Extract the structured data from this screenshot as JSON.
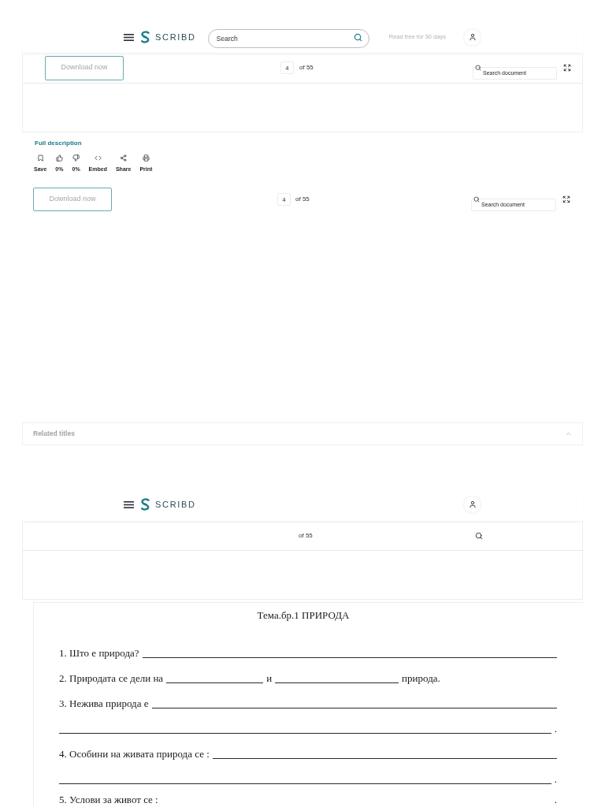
{
  "header": {
    "logo": "SCRIBD",
    "search": {
      "placeholder": "Search"
    },
    "promo": "Read free for 30 days"
  },
  "viewer": {
    "download": "Download now",
    "page": {
      "value": "4"
    },
    "page_total": "of 55",
    "search": {
      "placeholder": "Search document"
    }
  },
  "description_link": "Full description",
  "actions": [
    {
      "kind": "save",
      "label": "Save"
    },
    {
      "kind": "like",
      "label": "0%"
    },
    {
      "kind": "dislike",
      "label": "0%"
    },
    {
      "kind": "embed",
      "label": "Embed"
    },
    {
      "kind": "share",
      "label": "Share"
    },
    {
      "kind": "print",
      "label": "Print"
    }
  ],
  "viewer_2": {
    "download": "Download now",
    "page": {
      "value": "4"
    },
    "page_total": "of 55",
    "search": {
      "placeholder": "Search document"
    }
  },
  "related_titles": "Related titles",
  "sticky_header": {
    "logo": "SCRIBD"
  },
  "sticky_viewer": {
    "page_total": "of 55"
  },
  "document": {
    "title": "Тема.бр.1 ПРИРОДА",
    "lines": [
      {
        "parts": [
          {
            "kind": "text",
            "text": "1. Што е природа?"
          },
          {
            "kind": "blank"
          }
        ]
      },
      {
        "parts": [
          {
            "kind": "text",
            "text": "2. Природата се дели на"
          },
          {
            "kind": "blank"
          },
          {
            "kind": "text",
            "text": "и"
          },
          {
            "kind": "blank"
          },
          {
            "kind": "text",
            "text": "природа."
          }
        ]
      },
      {
        "parts": [
          {
            "kind": "text",
            "text": "3. Нежива природа е"
          },
          {
            "kind": "blank"
          }
        ]
      },
      {
        "parts": [
          {
            "kind": "blank"
          }
        ],
        "end": "."
      },
      {
        "parts": [
          {
            "kind": "text",
            "text": "4. Особини на живата природа се :"
          },
          {
            "kind": "blank"
          }
        ]
      },
      {
        "parts": [
          {
            "kind": "blank"
          }
        ],
        "end": "."
      },
      {
        "parts": [
          {
            "kind": "text",
            "text": "5. Услови за живот се :"
          }
        ],
        "end": "."
      }
    ]
  }
}
